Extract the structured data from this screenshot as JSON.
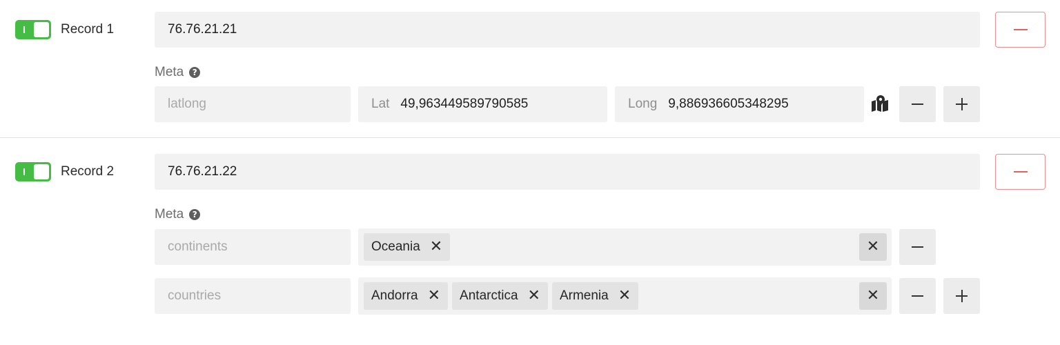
{
  "colors": {
    "toggle_on": "#45bd45",
    "remove_border": "#ef8c8c",
    "remove_icon": "#e85d5d"
  },
  "records": [
    {
      "label": "Record 1",
      "enabled": true,
      "value": "76.76.21.21",
      "meta_label": "Meta",
      "meta_help_icon": "question-circle-icon",
      "meta_key": "latlong",
      "lat_prefix": "Lat",
      "lat_value": "49,963449589790585",
      "long_prefix": "Long",
      "long_value": "9,886936605348295",
      "map_icon": "map-pin-icon"
    },
    {
      "label": "Record 2",
      "enabled": true,
      "value": "76.76.21.22",
      "meta_label": "Meta",
      "meta_help_icon": "question-circle-icon",
      "meta_rows": [
        {
          "key": "continents",
          "tags": [
            "Oceania"
          ]
        },
        {
          "key": "countries",
          "tags": [
            "Andorra",
            "Antarctica",
            "Armenia"
          ]
        }
      ]
    }
  ],
  "icons": {
    "remove": "minus-icon",
    "add": "plus-icon",
    "clear": "close-icon"
  }
}
